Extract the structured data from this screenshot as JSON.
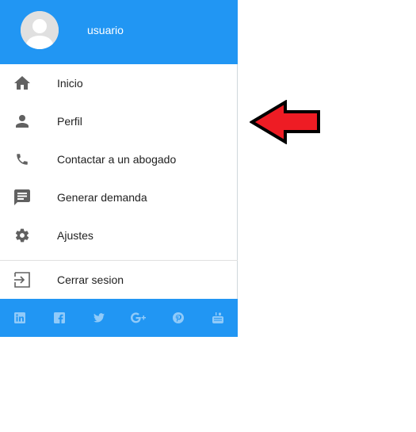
{
  "header": {
    "username": "usuario"
  },
  "menu": {
    "items": [
      {
        "label": "Inicio",
        "icon": "home-icon"
      },
      {
        "label": "Perfil",
        "icon": "person-icon"
      },
      {
        "label": "Contactar a un abogado",
        "icon": "phone-icon"
      },
      {
        "label": "Generar demanda",
        "icon": "message-icon"
      },
      {
        "label": "Ajustes",
        "icon": "gear-icon"
      }
    ],
    "logout": {
      "label": "Cerrar sesion",
      "icon": "logout-icon"
    }
  },
  "footer": {
    "social": [
      "linkedin-icon",
      "facebook-icon",
      "twitter-icon",
      "google-plus-icon",
      "pinterest-icon",
      "youtube-icon"
    ]
  },
  "colors": {
    "primary": "#2196f3",
    "icon_gray": "#616161",
    "social_icon": "#90caf9",
    "arrow_red": "#ee1c24"
  }
}
